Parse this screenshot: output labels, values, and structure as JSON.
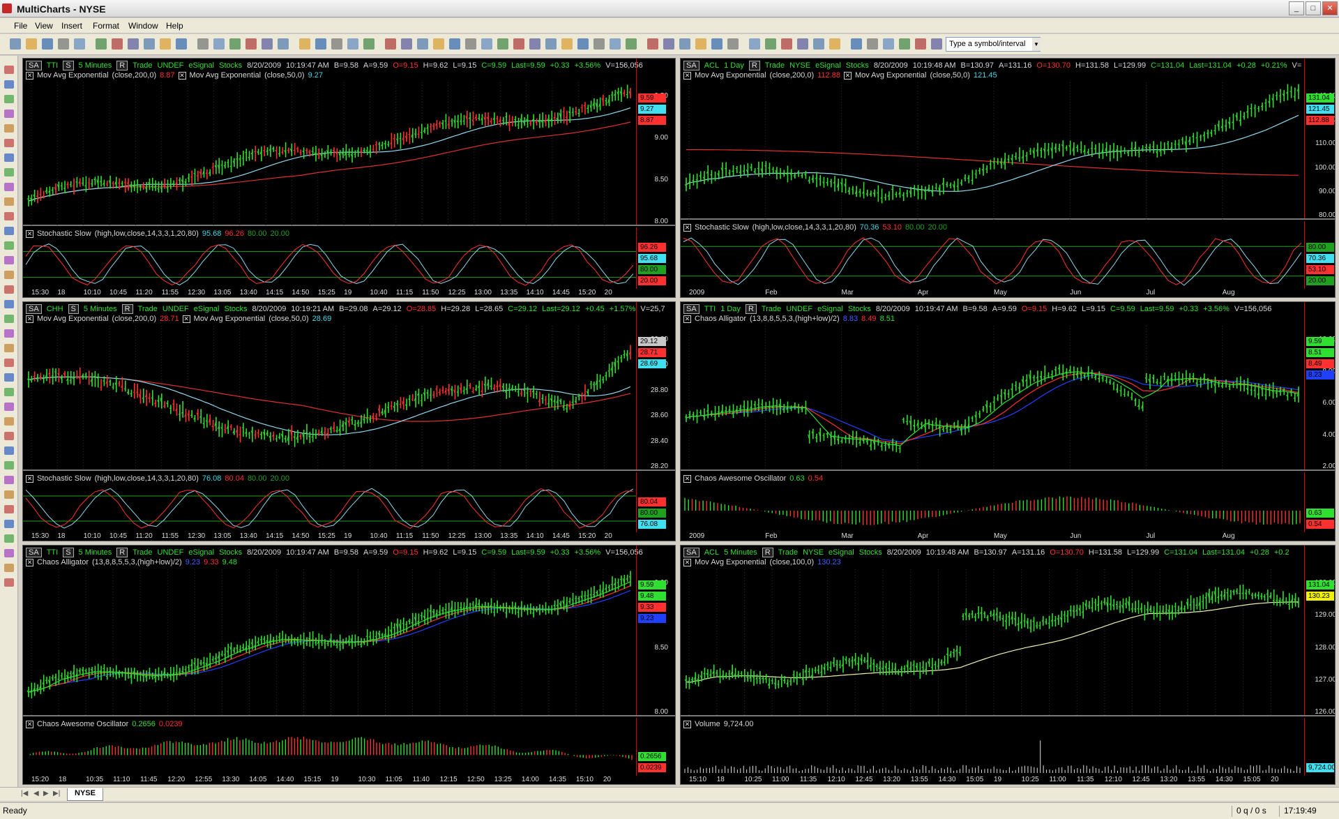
{
  "window": {
    "title": "MultiCharts - NYSE",
    "min": "_",
    "max": "□",
    "close": "✕"
  },
  "menu": [
    "File",
    "View",
    "Insert",
    "Format",
    "Window",
    "Help"
  ],
  "toolbar": {
    "symbol_placeholder": "Type a symbol/interval"
  },
  "tabs": {
    "active": "NYSE"
  },
  "status": {
    "left": "Ready",
    "queue": "0 q / 0 s",
    "clock": "17:19:49"
  },
  "charts": [
    {
      "id": "tti-5m",
      "header": {
        "sa": "SA",
        "sym": "TTI",
        "s": "S",
        "res": "5 Minutes",
        "r": "R",
        "trade": "Trade",
        "exch": "UNDEF",
        "feed": "eSignal",
        "cat": "Stocks",
        "date": "8/20/2009",
        "time": "10:19:47 AM",
        "b": "B=9.58",
        "a": "A=9.59",
        "o": "O=9.15",
        "h": "H=9.62",
        "l": "L=9.15",
        "c": "C=9.59",
        "last": "Last=9.59",
        "chg": "+0.33",
        "pct": "+3.56%",
        "v": "V=156,056"
      },
      "ind1": {
        "name": "Mov Avg Exponential",
        "params": "(close,200,0)",
        "val": "8.87",
        "name2": "Mov Avg Exponential",
        "params2": "(close,50,0)",
        "val2": "9.27"
      },
      "prices": [
        "9.50",
        "9.00",
        "8.50",
        "8.00"
      ],
      "tags": [
        {
          "v": "9.59",
          "c": "#ff3030"
        },
        {
          "v": "9.27",
          "c": "#40e0f0"
        },
        {
          "v": "8.87",
          "c": "#ff3030"
        }
      ],
      "sub": {
        "name": "Stochastic Slow",
        "params": "(high,low,close,14,3,3,1,20,80)",
        "v1": "95.68",
        "v2": "96.26",
        "v3": "80.00",
        "v4": "20.00"
      },
      "subtags": [
        {
          "v": "96.26",
          "c": "#ff3030"
        },
        {
          "v": "95.68",
          "c": "#40e0f0"
        },
        {
          "v": "80.00",
          "c": "#1fa01f"
        },
        {
          "v": "20.00",
          "c": "#ff3030"
        }
      ],
      "xticks": [
        "15:30",
        "18",
        "10:10",
        "10:45",
        "11:20",
        "11:55",
        "12:30",
        "13:05",
        "13:40",
        "14:15",
        "14:50",
        "15:25",
        "19",
        "10:40",
        "11:15",
        "11:50",
        "12:25",
        "13:00",
        "13:35",
        "14:10",
        "14:45",
        "15:20",
        "20"
      ]
    },
    {
      "id": "acl-1d",
      "header": {
        "sa": "SA",
        "sym": "ACL",
        "s": "",
        "res": "1 Day",
        "r": "R",
        "trade": "Trade",
        "exch": "NYSE",
        "feed": "eSignal",
        "cat": "Stocks",
        "date": "8/20/2009",
        "time": "10:19:48 AM",
        "b": "B=130.97",
        "a": "A=131.16",
        "o": "O=130.70",
        "h": "H=131.58",
        "l": "L=129.99",
        "c": "C=131.04",
        "last": "Last=131.04",
        "chg": "+0.28",
        "pct": "+0.21%",
        "v": "V="
      },
      "ind1": {
        "name": "Mov Avg Exponential",
        "params": "(close,200,0)",
        "val": "112.88",
        "name2": "Mov Avg Exponential",
        "params2": "(close,50,0)",
        "val2": "121.45"
      },
      "prices": [
        "140.00",
        "120.00",
        "110.00",
        "100.00",
        "90.00",
        "80.00"
      ],
      "tags": [
        {
          "v": "131.04",
          "c": "#30e030"
        },
        {
          "v": "121.45",
          "c": "#40e0f0"
        },
        {
          "v": "112.88",
          "c": "#ff3030"
        }
      ],
      "sub": {
        "name": "Stochastic Slow",
        "params": "(high,low,close,14,3,3,1,20,80)",
        "v1": "70.36",
        "v2": "53.10",
        "v3": "80.00",
        "v4": "20.00"
      },
      "subtags": [
        {
          "v": "80.00",
          "c": "#1fa01f"
        },
        {
          "v": "70.36",
          "c": "#40e0f0"
        },
        {
          "v": "53.10",
          "c": "#ff3030"
        },
        {
          "v": "20.00",
          "c": "#1fa01f"
        }
      ],
      "xticks": [
        "2009",
        "Feb",
        "Mar",
        "Apr",
        "May",
        "Jun",
        "Jul",
        "Aug"
      ]
    },
    {
      "id": "chh-5m",
      "header": {
        "sa": "SA",
        "sym": "CHH",
        "s": "S",
        "res": "5 Minutes",
        "r": "R",
        "trade": "Trade",
        "exch": "UNDEF",
        "feed": "eSignal",
        "cat": "Stocks",
        "date": "8/20/2009",
        "time": "10:19:21 AM",
        "b": "B=29.08",
        "a": "A=29.12",
        "o": "O=28.85",
        "h": "H=29.28",
        "l": "L=28.65",
        "c": "C=29.12",
        "last": "Last=29.12",
        "chg": "+0.45",
        "pct": "+1.57%",
        "v": "V=25,7"
      },
      "ind1": {
        "name": "Mov Avg Exponential",
        "params": "(close,200,0)",
        "val": "28.71",
        "name2": "Mov Avg Exponential",
        "params2": "(close,50,0)",
        "val2": "28.69"
      },
      "prices": [
        "29.20",
        "29.00",
        "28.80",
        "28.60",
        "28.40",
        "28.20"
      ],
      "tags": [
        {
          "v": "29.12",
          "c": "#c8c8c8"
        },
        {
          "v": "28.71",
          "c": "#ff3030"
        },
        {
          "v": "28.69",
          "c": "#40e0f0"
        }
      ],
      "sub": {
        "name": "Stochastic Slow",
        "params": "(high,low,close,14,3,3,1,20,80)",
        "v1": "76.08",
        "v2": "80.04",
        "v3": "80.00",
        "v4": "20.00"
      },
      "subtags": [
        {
          "v": "80.04",
          "c": "#ff3030"
        },
        {
          "v": "80.00",
          "c": "#1fa01f"
        },
        {
          "v": "76.08",
          "c": "#40e0f0"
        }
      ],
      "xticks": [
        "15:30",
        "18",
        "10:10",
        "10:45",
        "11:20",
        "11:55",
        "12:30",
        "13:05",
        "13:40",
        "14:15",
        "14:50",
        "15:25",
        "19",
        "10:40",
        "11:15",
        "11:50",
        "12:25",
        "13:00",
        "13:35",
        "14:10",
        "14:45",
        "15:20",
        "20"
      ]
    },
    {
      "id": "tti-1d",
      "header": {
        "sa": "SA",
        "sym": "TTI",
        "s": "",
        "res": "1 Day",
        "r": "R",
        "trade": "Trade",
        "exch": "UNDEF",
        "feed": "eSignal",
        "cat": "Stocks",
        "date": "8/20/2009",
        "time": "10:19:47 AM",
        "b": "B=9.58",
        "a": "A=9.59",
        "o": "O=9.15",
        "h": "H=9.62",
        "l": "L=9.15",
        "c": "C=9.59",
        "last": "Last=9.59",
        "chg": "+0.33",
        "pct": "+3.56%",
        "v": "V=156,056"
      },
      "ind1": {
        "name": "Chaos Alligator",
        "params": "(13,8,8,5,5,3,(high+low)/2)",
        "val": "8.83",
        "name2": "",
        "params2": "8.49",
        "val2": "8.51"
      },
      "prices": [
        "10.00",
        "8.00",
        "6.00",
        "4.00",
        "2.00"
      ],
      "tags": [
        {
          "v": "9.59",
          "c": "#30e030"
        },
        {
          "v": "8.51",
          "c": "#30e030"
        },
        {
          "v": "8.49",
          "c": "#ff3030"
        },
        {
          "v": "8.23",
          "c": "#2040ff"
        }
      ],
      "sub": {
        "name": "Chaos Awesome Oscillator",
        "params": "",
        "v1": "0.63",
        "v2": "0.54",
        "v3": "",
        "v4": ""
      },
      "subtags": [
        {
          "v": "0.63",
          "c": "#30e030"
        },
        {
          "v": "0.54",
          "c": "#ff3030"
        }
      ],
      "xticks": [
        "2009",
        "Feb",
        "Mar",
        "Apr",
        "May",
        "Jun",
        "Jul",
        "Aug"
      ]
    },
    {
      "id": "tti-5m-b",
      "header": {
        "sa": "SA",
        "sym": "TTI",
        "s": "S",
        "res": "5 Minutes",
        "r": "R",
        "trade": "Trade",
        "exch": "UNDEF",
        "feed": "eSignal",
        "cat": "Stocks",
        "date": "8/20/2009",
        "time": "10:19:47 AM",
        "b": "B=9.58",
        "a": "A=9.59",
        "o": "O=9.15",
        "h": "H=9.62",
        "l": "L=9.15",
        "c": "C=9.59",
        "last": "Last=9.59",
        "chg": "+0.33",
        "pct": "+3.56%",
        "v": "V=156,056"
      },
      "ind1": {
        "name": "Chaos Alligator",
        "params": "(13,8,8,5,5,3,(high+low)/2)",
        "val": "9.23",
        "name2": "",
        "params2": "9.33",
        "val2": "9.48"
      },
      "prices": [
        "9.00",
        "8.50",
        "8.00"
      ],
      "tags": [
        {
          "v": "9.59",
          "c": "#30e030"
        },
        {
          "v": "9.48",
          "c": "#30e030"
        },
        {
          "v": "9.33",
          "c": "#ff3030"
        },
        {
          "v": "9.23",
          "c": "#2040ff"
        }
      ],
      "sub": {
        "name": "Chaos Awesome Oscillator",
        "params": "",
        "v1": "0.2656",
        "v2": "0.0239",
        "v3": "",
        "v4": ""
      },
      "subtags": [
        {
          "v": "0.2656",
          "c": "#30e030"
        },
        {
          "v": "0.0239",
          "c": "#ff3030"
        }
      ],
      "xticks": [
        "15:20",
        "18",
        "10:35",
        "11:10",
        "11:45",
        "12:20",
        "12:55",
        "13:30",
        "14:05",
        "14:40",
        "15:15",
        "19",
        "10:30",
        "11:05",
        "11:40",
        "12:15",
        "12:50",
        "13:25",
        "14:00",
        "14:35",
        "15:10",
        "20"
      ]
    },
    {
      "id": "acl-5m",
      "header": {
        "sa": "SA",
        "sym": "ACL",
        "s": "",
        "res": "5 Minutes",
        "r": "R",
        "trade": "Trade",
        "exch": "NYSE",
        "feed": "eSignal",
        "cat": "Stocks",
        "date": "8/20/2009",
        "time": "10:19:48 AM",
        "b": "B=130.97",
        "a": "A=131.16",
        "o": "O=130.70",
        "h": "H=131.58",
        "l": "L=129.99",
        "c": "C=131.04",
        "last": "Last=131.04",
        "chg": "+0.28",
        "pct": "+0.2",
        "v": ""
      },
      "ind1": {
        "name": "Mov Avg Exponential",
        "params": "(close,100,0)",
        "val": "130.23",
        "name2": "",
        "params2": "",
        "val2": ""
      },
      "prices": [
        "130.00",
        "129.00",
        "128.00",
        "127.00",
        "126.00"
      ],
      "tags": [
        {
          "v": "131.04",
          "c": "#30e030"
        },
        {
          "v": "130.23",
          "c": "#f0f000"
        }
      ],
      "sub": {
        "name": "Volume",
        "params": "9,724.00",
        "v1": "",
        "v2": "",
        "v3": "",
        "v4": ""
      },
      "subtags": [
        {
          "v": "9,724.00",
          "c": "#40e0f0"
        }
      ],
      "xticks": [
        "15:10",
        "18",
        "10:25",
        "11:00",
        "11:35",
        "12:10",
        "12:45",
        "13:20",
        "13:55",
        "14:30",
        "15:05",
        "19",
        "10:25",
        "11:00",
        "11:35",
        "12:10",
        "12:45",
        "13:20",
        "13:55",
        "14:30",
        "15:05",
        "20"
      ]
    }
  ]
}
